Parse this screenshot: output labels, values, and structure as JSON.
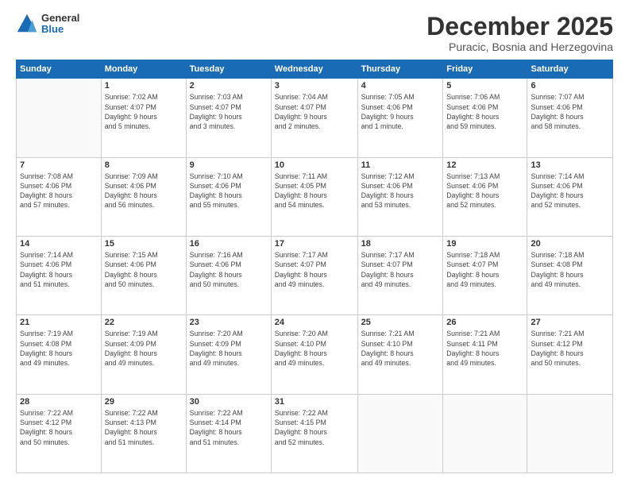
{
  "header": {
    "logo_general": "General",
    "logo_blue": "Blue",
    "month_title": "December 2025",
    "subtitle": "Puracic, Bosnia and Herzegovina"
  },
  "weekdays": [
    "Sunday",
    "Monday",
    "Tuesday",
    "Wednesday",
    "Thursday",
    "Friday",
    "Saturday"
  ],
  "weeks": [
    [
      {
        "day": "",
        "info": ""
      },
      {
        "day": "1",
        "info": "Sunrise: 7:02 AM\nSunset: 4:07 PM\nDaylight: 9 hours\nand 5 minutes."
      },
      {
        "day": "2",
        "info": "Sunrise: 7:03 AM\nSunset: 4:07 PM\nDaylight: 9 hours\nand 3 minutes."
      },
      {
        "day": "3",
        "info": "Sunrise: 7:04 AM\nSunset: 4:07 PM\nDaylight: 9 hours\nand 2 minutes."
      },
      {
        "day": "4",
        "info": "Sunrise: 7:05 AM\nSunset: 4:06 PM\nDaylight: 9 hours\nand 1 minute."
      },
      {
        "day": "5",
        "info": "Sunrise: 7:06 AM\nSunset: 4:06 PM\nDaylight: 8 hours\nand 59 minutes."
      },
      {
        "day": "6",
        "info": "Sunrise: 7:07 AM\nSunset: 4:06 PM\nDaylight: 8 hours\nand 58 minutes."
      }
    ],
    [
      {
        "day": "7",
        "info": "Sunrise: 7:08 AM\nSunset: 4:06 PM\nDaylight: 8 hours\nand 57 minutes."
      },
      {
        "day": "8",
        "info": "Sunrise: 7:09 AM\nSunset: 4:06 PM\nDaylight: 8 hours\nand 56 minutes."
      },
      {
        "day": "9",
        "info": "Sunrise: 7:10 AM\nSunset: 4:06 PM\nDaylight: 8 hours\nand 55 minutes."
      },
      {
        "day": "10",
        "info": "Sunrise: 7:11 AM\nSunset: 4:05 PM\nDaylight: 8 hours\nand 54 minutes."
      },
      {
        "day": "11",
        "info": "Sunrise: 7:12 AM\nSunset: 4:06 PM\nDaylight: 8 hours\nand 53 minutes."
      },
      {
        "day": "12",
        "info": "Sunrise: 7:13 AM\nSunset: 4:06 PM\nDaylight: 8 hours\nand 52 minutes."
      },
      {
        "day": "13",
        "info": "Sunrise: 7:14 AM\nSunset: 4:06 PM\nDaylight: 8 hours\nand 52 minutes."
      }
    ],
    [
      {
        "day": "14",
        "info": "Sunrise: 7:14 AM\nSunset: 4:06 PM\nDaylight: 8 hours\nand 51 minutes."
      },
      {
        "day": "15",
        "info": "Sunrise: 7:15 AM\nSunset: 4:06 PM\nDaylight: 8 hours\nand 50 minutes."
      },
      {
        "day": "16",
        "info": "Sunrise: 7:16 AM\nSunset: 4:06 PM\nDaylight: 8 hours\nand 50 minutes."
      },
      {
        "day": "17",
        "info": "Sunrise: 7:17 AM\nSunset: 4:07 PM\nDaylight: 8 hours\nand 49 minutes."
      },
      {
        "day": "18",
        "info": "Sunrise: 7:17 AM\nSunset: 4:07 PM\nDaylight: 8 hours\nand 49 minutes."
      },
      {
        "day": "19",
        "info": "Sunrise: 7:18 AM\nSunset: 4:07 PM\nDaylight: 8 hours\nand 49 minutes."
      },
      {
        "day": "20",
        "info": "Sunrise: 7:18 AM\nSunset: 4:08 PM\nDaylight: 8 hours\nand 49 minutes."
      }
    ],
    [
      {
        "day": "21",
        "info": "Sunrise: 7:19 AM\nSunset: 4:08 PM\nDaylight: 8 hours\nand 49 minutes."
      },
      {
        "day": "22",
        "info": "Sunrise: 7:19 AM\nSunset: 4:09 PM\nDaylight: 8 hours\nand 49 minutes."
      },
      {
        "day": "23",
        "info": "Sunrise: 7:20 AM\nSunset: 4:09 PM\nDaylight: 8 hours\nand 49 minutes."
      },
      {
        "day": "24",
        "info": "Sunrise: 7:20 AM\nSunset: 4:10 PM\nDaylight: 8 hours\nand 49 minutes."
      },
      {
        "day": "25",
        "info": "Sunrise: 7:21 AM\nSunset: 4:10 PM\nDaylight: 8 hours\nand 49 minutes."
      },
      {
        "day": "26",
        "info": "Sunrise: 7:21 AM\nSunset: 4:11 PM\nDaylight: 8 hours\nand 49 minutes."
      },
      {
        "day": "27",
        "info": "Sunrise: 7:21 AM\nSunset: 4:12 PM\nDaylight: 8 hours\nand 50 minutes."
      }
    ],
    [
      {
        "day": "28",
        "info": "Sunrise: 7:22 AM\nSunset: 4:12 PM\nDaylight: 8 hours\nand 50 minutes."
      },
      {
        "day": "29",
        "info": "Sunrise: 7:22 AM\nSunset: 4:13 PM\nDaylight: 8 hours\nand 51 minutes."
      },
      {
        "day": "30",
        "info": "Sunrise: 7:22 AM\nSunset: 4:14 PM\nDaylight: 8 hours\nand 51 minutes."
      },
      {
        "day": "31",
        "info": "Sunrise: 7:22 AM\nSunset: 4:15 PM\nDaylight: 8 hours\nand 52 minutes."
      },
      {
        "day": "",
        "info": ""
      },
      {
        "day": "",
        "info": ""
      },
      {
        "day": "",
        "info": ""
      }
    ]
  ]
}
